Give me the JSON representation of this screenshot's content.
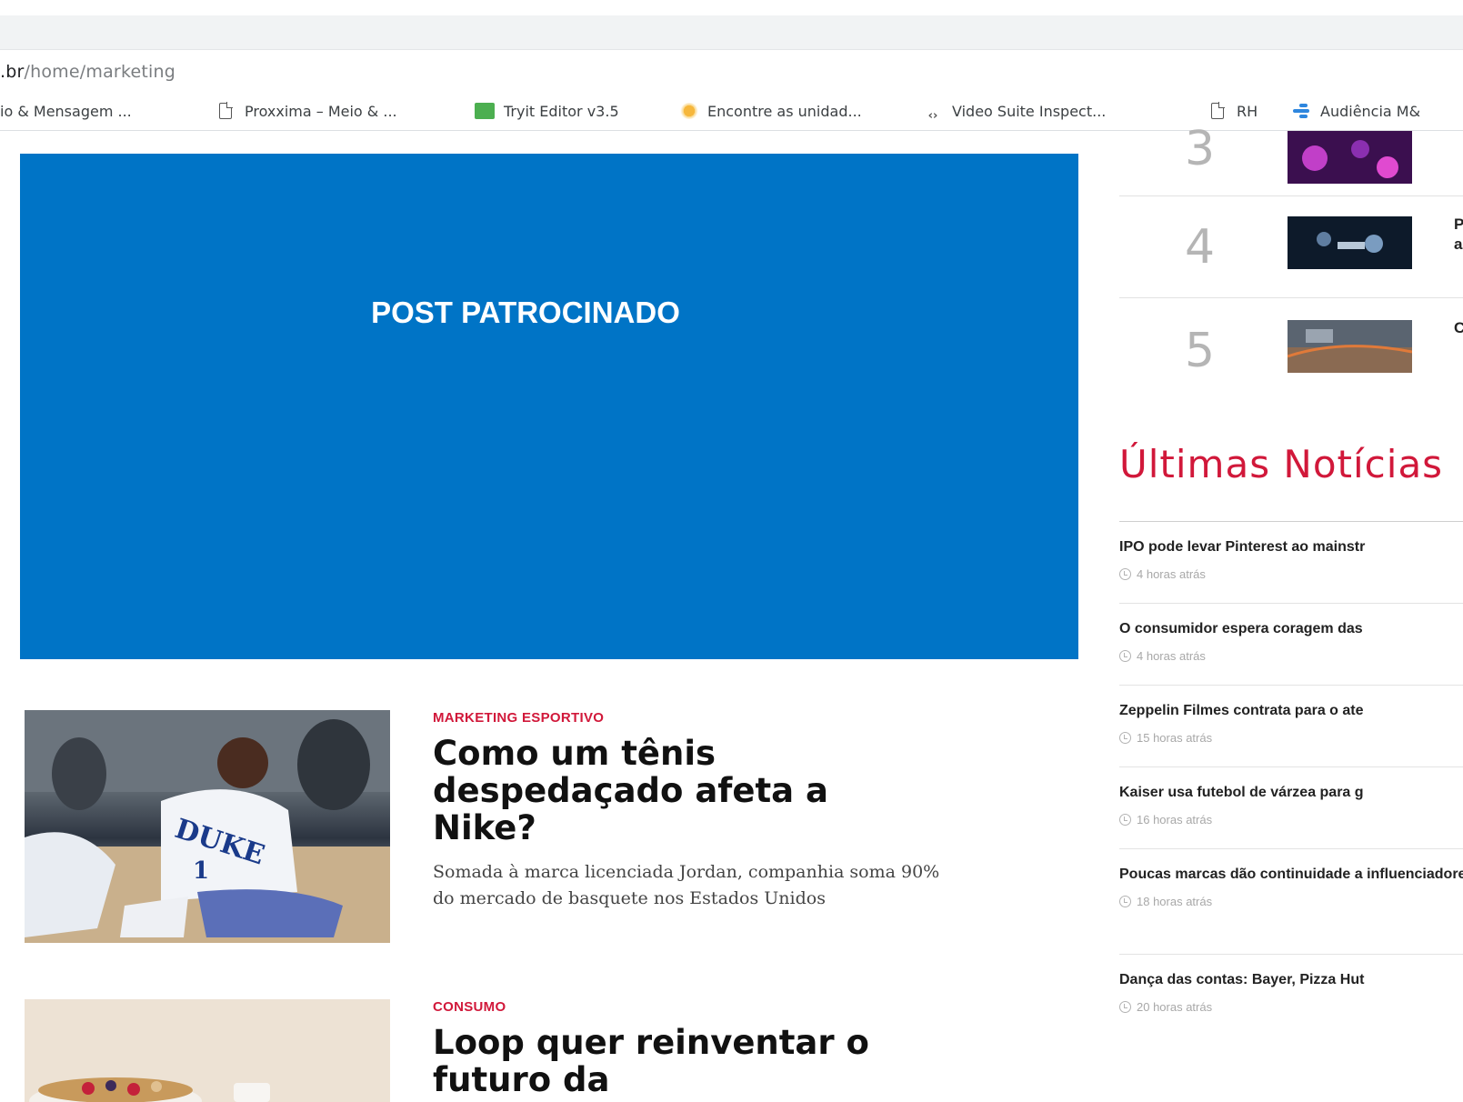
{
  "browser": {
    "url_host": ".br",
    "url_path": "/home/marketing",
    "bookmarks": [
      {
        "label": "io & Mensagem ...",
        "icon": "none"
      },
      {
        "label": "Proxxima – Meio & ...",
        "icon": "page-icon"
      },
      {
        "label": "Tryit Editor v3.5",
        "icon": "tryit-icon"
      },
      {
        "label": "Encontre as unidad...",
        "icon": "sun-icon"
      },
      {
        "label": "Video Suite Inspect...",
        "icon": "code-icon"
      },
      {
        "label": "RH",
        "icon": "page-icon"
      },
      {
        "label": "Audiência M&",
        "icon": "share-icon"
      }
    ]
  },
  "sponsor": {
    "label": "POST PATROCINADO",
    "background": "#0074c6"
  },
  "articles": [
    {
      "category": "MARKETING ESPORTIVO",
      "title": "Como um tênis despedaçado afeta a Nike?",
      "excerpt": "Somada à marca licenciada Jordan, companhia soma 90% do mercado de basquete nos Estados Unidos"
    },
    {
      "category": "CONSUMO",
      "title": "Loop quer reinventar o futuro da",
      "excerpt": ""
    }
  ],
  "ranking": [
    {
      "number": "3",
      "text": ""
    },
    {
      "number": "4",
      "text": "P\na"
    },
    {
      "number": "5",
      "text": "C"
    }
  ],
  "latest_news": {
    "title": "Últimas Notícias",
    "items": [
      {
        "headline": "IPO pode levar Pinterest ao mainstr",
        "time": "4 horas atrás"
      },
      {
        "headline": "O consumidor espera coragem das",
        "time": "4 horas atrás"
      },
      {
        "headline": "Zeppelin Filmes contrata para o ate",
        "time": "15 horas atrás"
      },
      {
        "headline": "Kaiser usa futebol de várzea para g",
        "time": "16 horas atrás"
      },
      {
        "headline": "Poucas marcas dão continuidade a influenciadores",
        "time": "18 horas atrás"
      },
      {
        "headline": "Dança das contas: Bayer, Pizza Hut",
        "time": "20 horas atrás"
      }
    ]
  },
  "colors": {
    "accent": "#d1183a",
    "sponsor_blue": "#0074c6"
  }
}
